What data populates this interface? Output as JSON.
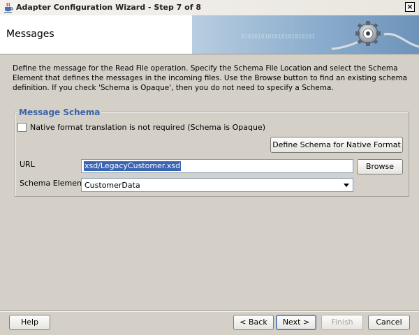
{
  "window": {
    "title": "Adapter Configuration Wizard - Step 7 of 8",
    "close_label": "×"
  },
  "header": {
    "title": "Messages",
    "banner_bits": "0101010101010101010101"
  },
  "description": "Define the message for the Read File operation.  Specify the Schema File Location and select the Schema Element that defines the messages in the incoming files. Use the Browse button to find an existing schema definition. If you check 'Schema is Opaque', then you do not need to specify a Schema.",
  "message_schema": {
    "legend": "Message Schema",
    "opaque_checkbox_label": "Native format translation is not required (Schema is Opaque)",
    "opaque_checked": false,
    "define_native_button": "Define Schema for Native Format",
    "url_label": "URL",
    "url_value": "xsd/LegacyCustomer.xsd",
    "browse_button": "Browse",
    "schema_element_label": "Schema Element",
    "schema_element_value": "CustomerData"
  },
  "footer": {
    "help": "Help",
    "back": "< Back",
    "next": "Next >",
    "finish": "Finish",
    "cancel": "Cancel"
  },
  "colors": {
    "legend": "#3b63a8",
    "selection": "#3b65b2",
    "window_bg": "#d4d0c8"
  }
}
